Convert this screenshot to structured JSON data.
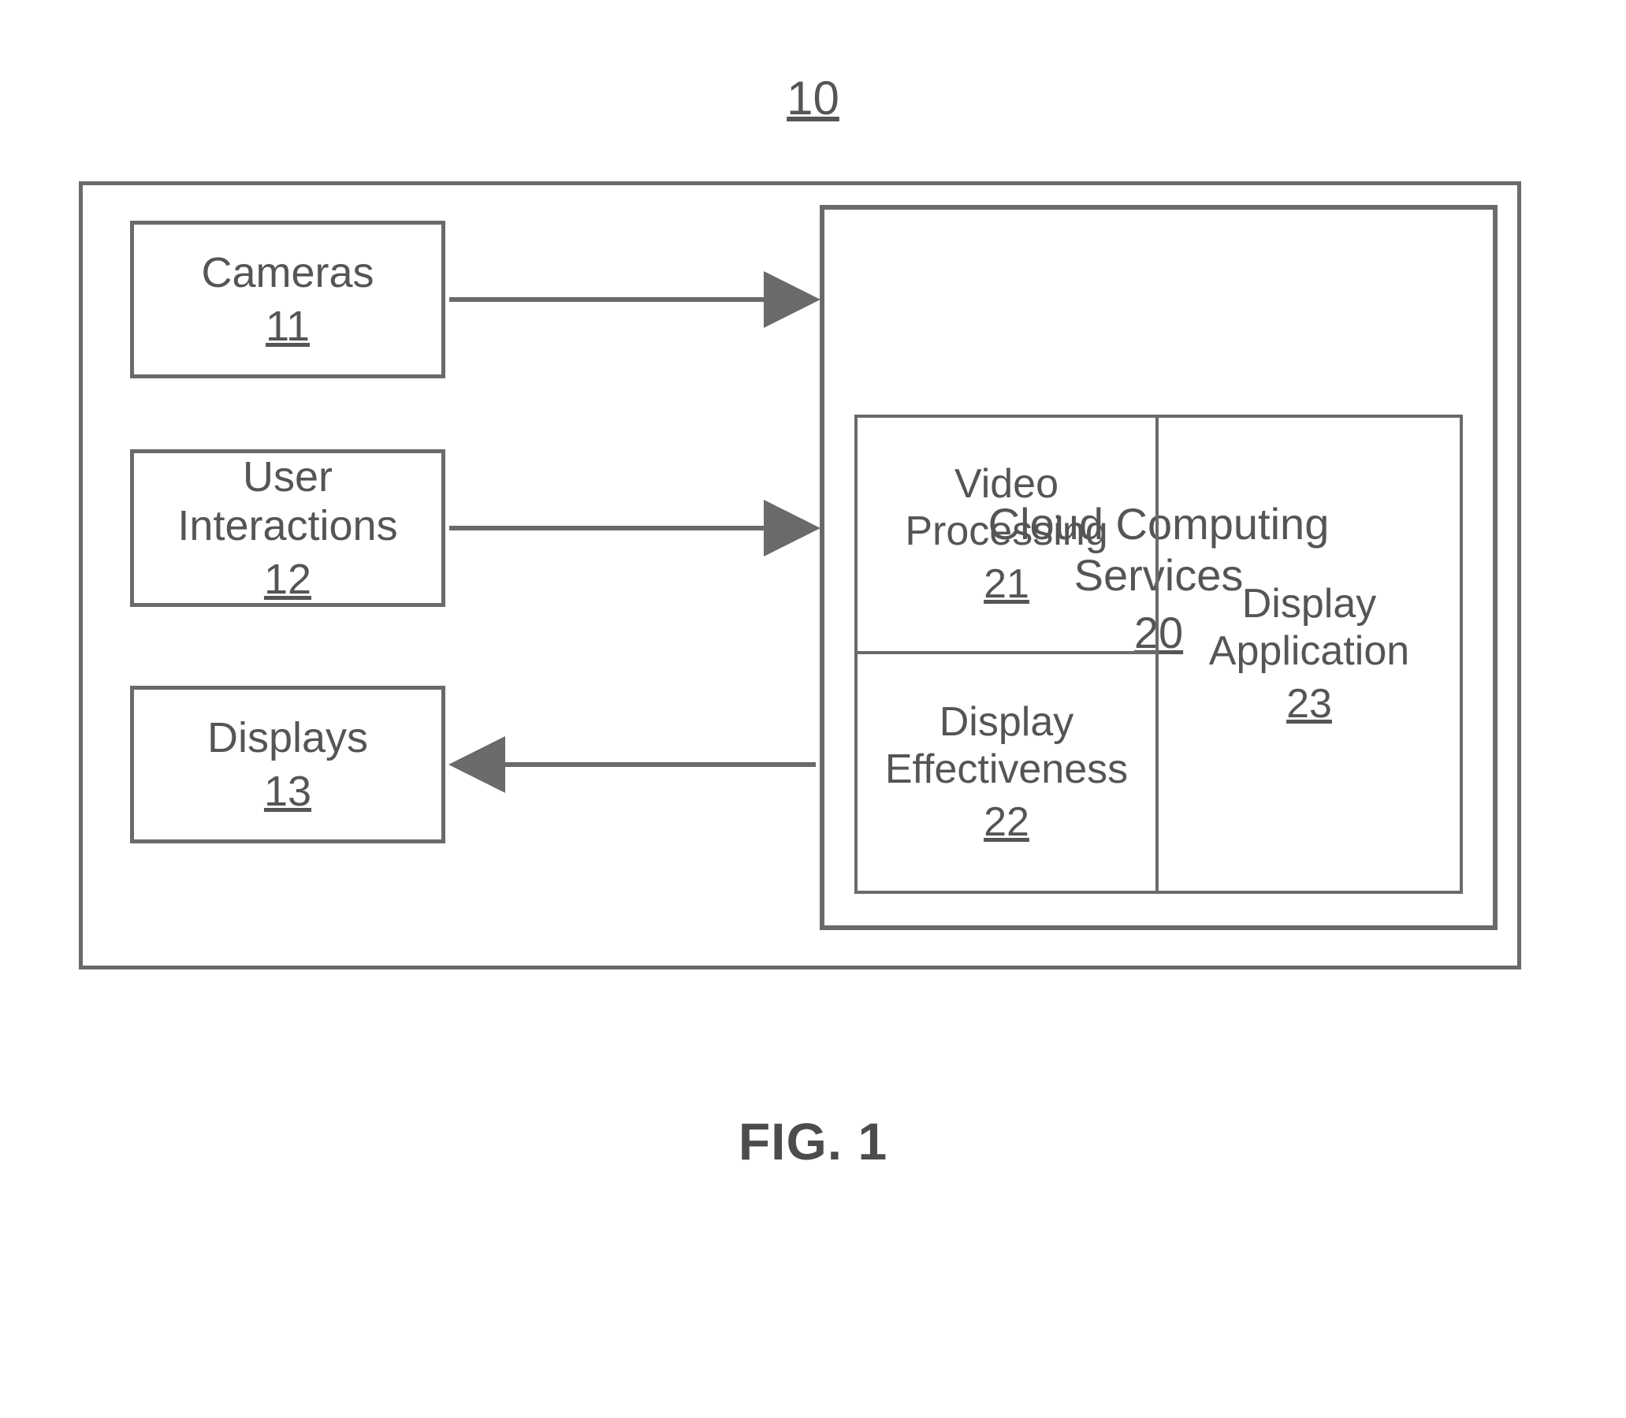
{
  "system": {
    "ref": "10"
  },
  "left_blocks": {
    "cameras": {
      "label": "Cameras",
      "ref": "11"
    },
    "user_int": {
      "label": "User\nInteractions",
      "ref": "12"
    },
    "displays": {
      "label": "Displays",
      "ref": "13"
    }
  },
  "cloud": {
    "label": "Cloud Computing\nServices",
    "ref": "20",
    "cells": {
      "video_proc": {
        "label": "Video\nProcessing",
        "ref": "21"
      },
      "disp_effect": {
        "label": "Display\nEffectiveness",
        "ref": "22"
      },
      "disp_app": {
        "label": "Display\nApplication",
        "ref": "23"
      }
    }
  },
  "figure_caption": "FIG. 1",
  "arrows": [
    {
      "from": "cameras",
      "to": "cloud",
      "dir": "right"
    },
    {
      "from": "user_int",
      "to": "cloud",
      "dir": "right"
    },
    {
      "from": "cloud",
      "to": "displays",
      "dir": "left"
    }
  ]
}
